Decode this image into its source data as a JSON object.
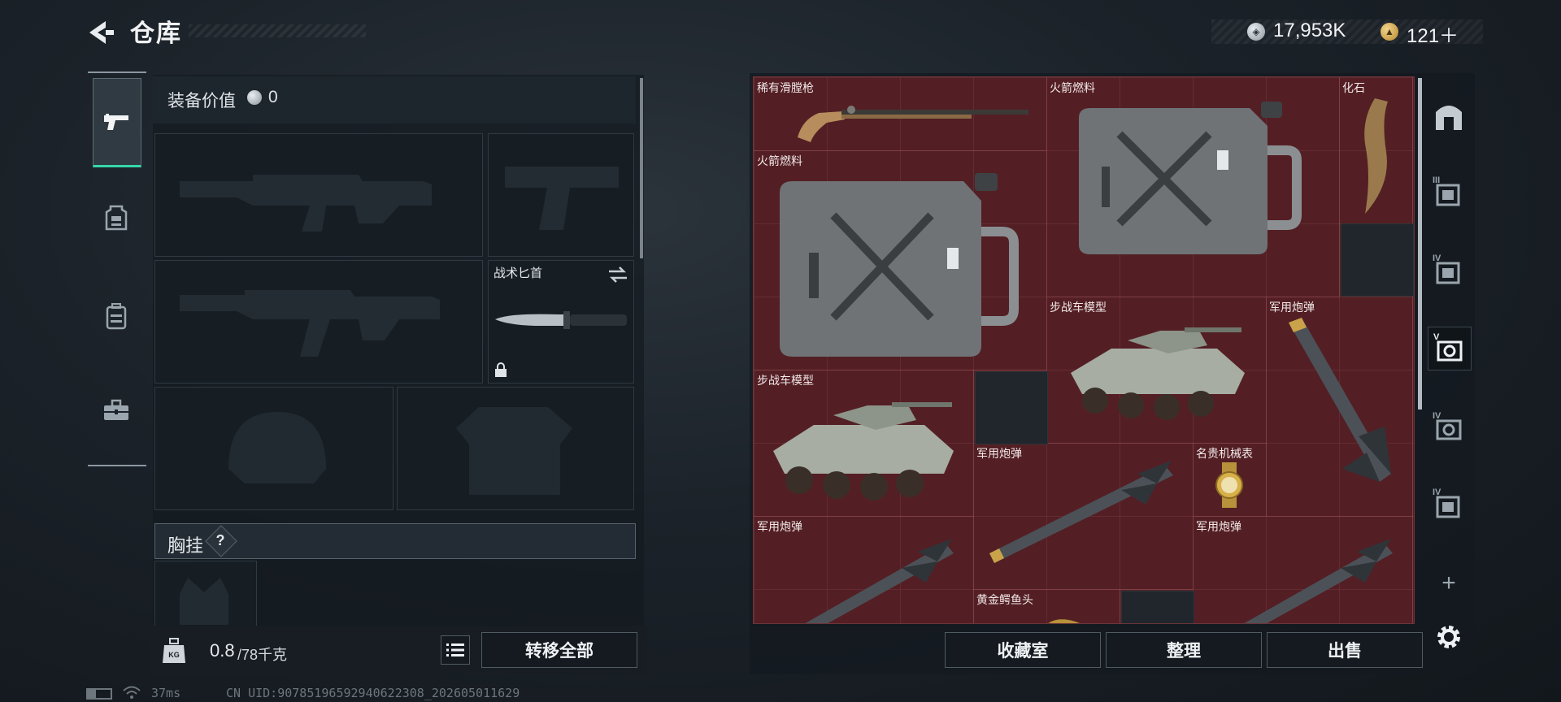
{
  "header": {
    "title": "仓库",
    "silver_amount": "17,953K",
    "gold_amount": "121＋"
  },
  "loadout": {
    "value_label": "装备价值",
    "value": "0",
    "knife_label": "战术匕首",
    "chest_rig_label": "胸挂",
    "help_label": "?",
    "weight_current": "0.8",
    "weight_max": "/78千克",
    "weight_icon_text": "KG",
    "transfer_all_label": "转移全部"
  },
  "storage": {
    "items": [
      {
        "id": "musket",
        "label": "稀有滑膛枪"
      },
      {
        "id": "fuel1",
        "label": "火箭燃料"
      },
      {
        "id": "fossil",
        "label": "化石"
      },
      {
        "id": "fuel2",
        "label": "火箭燃料"
      },
      {
        "id": "ifv1",
        "label": "步战车模型"
      },
      {
        "id": "shell1",
        "label": "军用炮弹"
      },
      {
        "id": "ifv2",
        "label": "步战车模型"
      },
      {
        "id": "shell2",
        "label": "军用炮弹"
      },
      {
        "id": "watch",
        "label": "名贵机械表"
      },
      {
        "id": "shell3",
        "label": "军用炮弹"
      },
      {
        "id": "croc",
        "label": "黄金鳄鱼头"
      },
      {
        "id": "shell4",
        "label": "军用炮弹"
      }
    ],
    "side_tabs": [
      "III",
      "IV",
      "V",
      "IV",
      "IV"
    ],
    "collection_label": "收藏室",
    "sort_label": "整理",
    "sell_label": "出售"
  },
  "status": {
    "ping": "37ms",
    "uid": "CN UID:9078519659294062230​8_202605011629"
  },
  "colors": {
    "accent": "#35d7a9",
    "storage_bg": "#531f24"
  }
}
